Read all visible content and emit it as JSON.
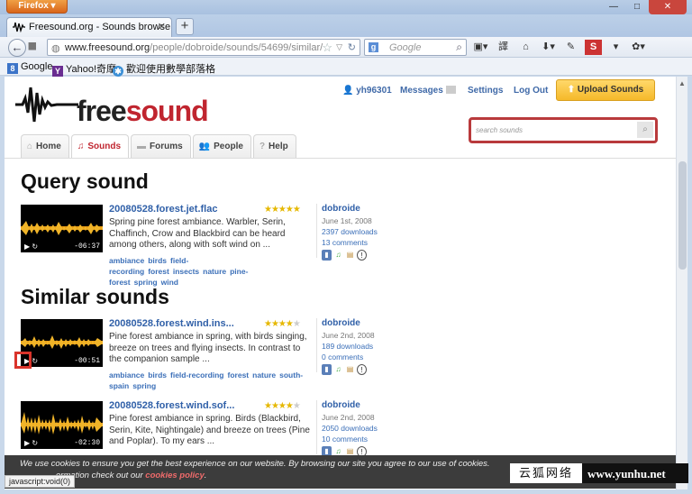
{
  "browser": {
    "menu_label": "Firefox",
    "tab_title": "Freesound.org - Sounds browse",
    "url_domain": "www.freesound.org",
    "url_path": "/people/dobroide/sounds/54699/similar/",
    "search_placeholder": "Google",
    "bookmarks": [
      "Google",
      "Yahoo!奇摩",
      "歡迎使用數學部落格"
    ],
    "status_text": "javascript:void(0)"
  },
  "header": {
    "logo_text_a": "free",
    "logo_text_b": "sound",
    "username": "yh96301",
    "messages_label": "Messages",
    "settings_label": "Settings",
    "logout_label": "Log Out",
    "upload_label": "Upload Sounds",
    "search_placeholder": "search sounds"
  },
  "nav": {
    "tabs": [
      {
        "label": "Home",
        "icon": "home-icon"
      },
      {
        "label": "Sounds",
        "icon": "headphones-icon",
        "active": true
      },
      {
        "label": "Forums",
        "icon": "speech-icon"
      },
      {
        "label": "People",
        "icon": "people-icon"
      },
      {
        "label": "Help",
        "icon": "help-icon"
      }
    ]
  },
  "query_heading": "Query sound",
  "similar_heading": "Similar sounds",
  "sounds": [
    {
      "title": "20080528.forest.jet.flac",
      "description": "Spring pine forest ambiance. Warbler, Serin, Chaffinch, Crow and Blackbird can be heard among others, along with soft wind on ...",
      "tags": [
        "ambiance",
        "birds",
        "field-recording",
        "forest",
        "insects",
        "nature",
        "pine-forest",
        "spring",
        "wind"
      ],
      "user": "dobroide",
      "date": "June 1st, 2008",
      "downloads": "2397 downloads",
      "comments": "13 comments",
      "duration": "-06:37",
      "rating": 5
    },
    {
      "title": "20080528.forest.wind.ins...",
      "description": "Pine forest ambiance in spring, with birds singing, breeze on trees and flying insects. In contrast to the companion sample ...",
      "tags": [
        "ambiance",
        "birds",
        "field-recording",
        "forest",
        "nature",
        "south-spain",
        "spring"
      ],
      "user": "dobroide",
      "date": "June 2nd, 2008",
      "downloads": "189 downloads",
      "comments": "0 comments",
      "duration": "-00:51",
      "rating": 4
    },
    {
      "title": "20080528.forest.wind.sof...",
      "description": "Pine forest ambiance in spring. Birds (Blackbird, Serin, Kite, Nightingale) and breeze on trees (Pine and Poplar). To my ears ...",
      "tags": [],
      "user": "dobroide",
      "date": "June 2nd, 2008",
      "downloads": "2050 downloads",
      "comments": "10 comments",
      "duration": "-02:30",
      "rating": 4
    }
  ],
  "cookie": {
    "line1": "We use cookies to ensure you get the best experience on our website. By browsing our site you agree to our use of cookies.",
    "line2": "ormation check out our",
    "link": "cookies policy",
    "line2_end": "."
  },
  "watermark": {
    "cn": "云狐网络",
    "en": "www.yunhu.net"
  },
  "colors": {
    "brand_red": "#c0252f",
    "link_blue": "#3060a8",
    "upload_yellow": "#f5b92a"
  }
}
